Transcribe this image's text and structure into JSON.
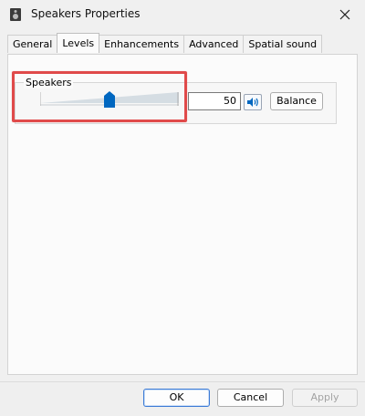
{
  "window": {
    "title": "Speakers Properties",
    "app_icon": "speaker-device-icon",
    "close_icon": "close-icon"
  },
  "tabs": [
    {
      "label": "General"
    },
    {
      "label": "Levels",
      "active": true
    },
    {
      "label": "Enhancements"
    },
    {
      "label": "Advanced"
    },
    {
      "label": "Spatial sound"
    }
  ],
  "levels": {
    "group_label": "Speakers",
    "volume_value": "50",
    "volume_level": 50,
    "volume_range": [
      0,
      100
    ],
    "mute_icon": "speaker-volume-icon",
    "balance_label": "Balance"
  },
  "buttons": {
    "ok": "OK",
    "cancel": "Cancel",
    "apply": "Apply"
  },
  "colors": {
    "accent": "#0067c0",
    "highlight": "#e04a4a"
  }
}
